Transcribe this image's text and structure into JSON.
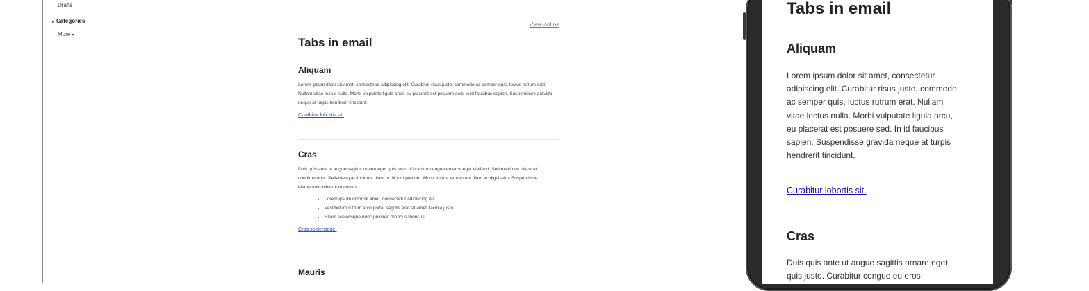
{
  "sidebar": {
    "drafts": "Drafts",
    "categories": "Categories",
    "more": "More"
  },
  "email": {
    "view_online": "View online",
    "title": "Tabs in email",
    "sections": [
      {
        "heading": "Aliquam",
        "body": "Lorem ipsum dolor sit amet, consectetur adipiscing elit. Curabitur risus justo, commodo ac semper quis, luctus rutrum erat. Nullam vitae lectus nulla. Morbi vulputate ligula arcu, eu placerat est posuere sed. In id faucibus sapien. Suspendisse gravida neque at turpis hendrerit tincidunt.",
        "link": "Curabitur lobortis sit."
      },
      {
        "heading": "Cras",
        "body": "Duis quis ante ut augue sagittis ornare eget quis justo. Curabitur congue eu eros eget eleifend. Sed maximus placerat condimentum. Pellentesque tincidunt diam ut dictum pretium. Morbi luctus fermentum diam ac dignissim. Suspendisse elementum bibendum cursus.",
        "bullets": [
          "Lorem ipsum dolor sit amet, consectetur adipiscing elit.",
          "Vestibulum rutrum arcu porta, sagittis erat sit amet, lacinia justo.",
          "Etiam scelerisque nunc pulvinar rhoncus rhoncus."
        ],
        "link": "Cras scelerisque."
      },
      {
        "heading": "Mauris"
      }
    ]
  },
  "mobile": {
    "title": "Tabs in email",
    "section1_heading": "Aliquam",
    "section1_body": "Lorem ipsum dolor sit amet, consectetur adipiscing elit. Curabitur risus justo, commodo ac semper quis, luctus rutrum erat. Nullam vitae lectus nulla. Morbi vulputate ligula arcu, eu placerat est posuere sed. In id faucibus sapien. Suspendisse gravida neque at turpis hendrerit tincidunt.",
    "section1_link": "Curabitur lobortis sit.",
    "section2_heading": "Cras",
    "section2_body": "Duis quis ante ut augue sagittis ornare eget quis justo. Curabitur congue eu eros"
  },
  "colors": {
    "link_desktop": "#2b50c8",
    "link_mobile": "#1a0dab",
    "logo_accent": "#1a73e8"
  }
}
